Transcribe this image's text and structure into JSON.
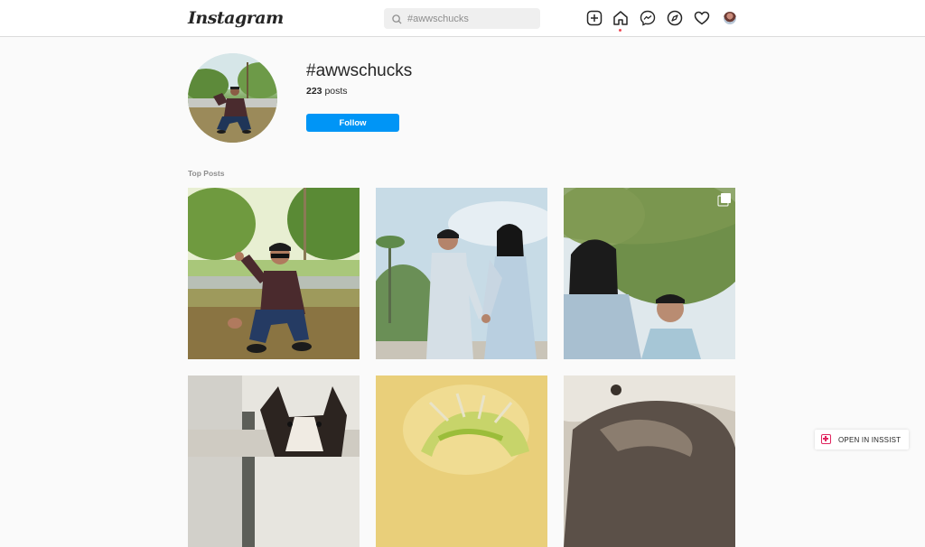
{
  "header": {
    "logo_text": "Instagram",
    "search_placeholder": "#awwschucks",
    "icons": [
      "new-post-icon",
      "home-icon",
      "messenger-icon",
      "explore-icon",
      "heart-icon",
      "profile-avatar"
    ]
  },
  "profile": {
    "hashtag": "#awwschucks",
    "posts_count": "223",
    "posts_suffix": "posts",
    "follow_label": "Follow"
  },
  "sections": {
    "top_posts_label": "Top Posts"
  },
  "posts": [
    {
      "name": "young man crouching in park",
      "multi": false
    },
    {
      "name": "couple in traditional outfits",
      "multi": false
    },
    {
      "name": "couple under trees",
      "multi": true
    },
    {
      "name": "puppy",
      "multi": false
    },
    {
      "name": "green and yellow object",
      "multi": false
    },
    {
      "name": "rock close-up",
      "multi": false
    }
  ],
  "extension": {
    "label": "OPEN IN INSSIST"
  },
  "colors": {
    "accent": "#0095f6",
    "notification_dot": "#ed4956",
    "background": "#fafafa"
  }
}
